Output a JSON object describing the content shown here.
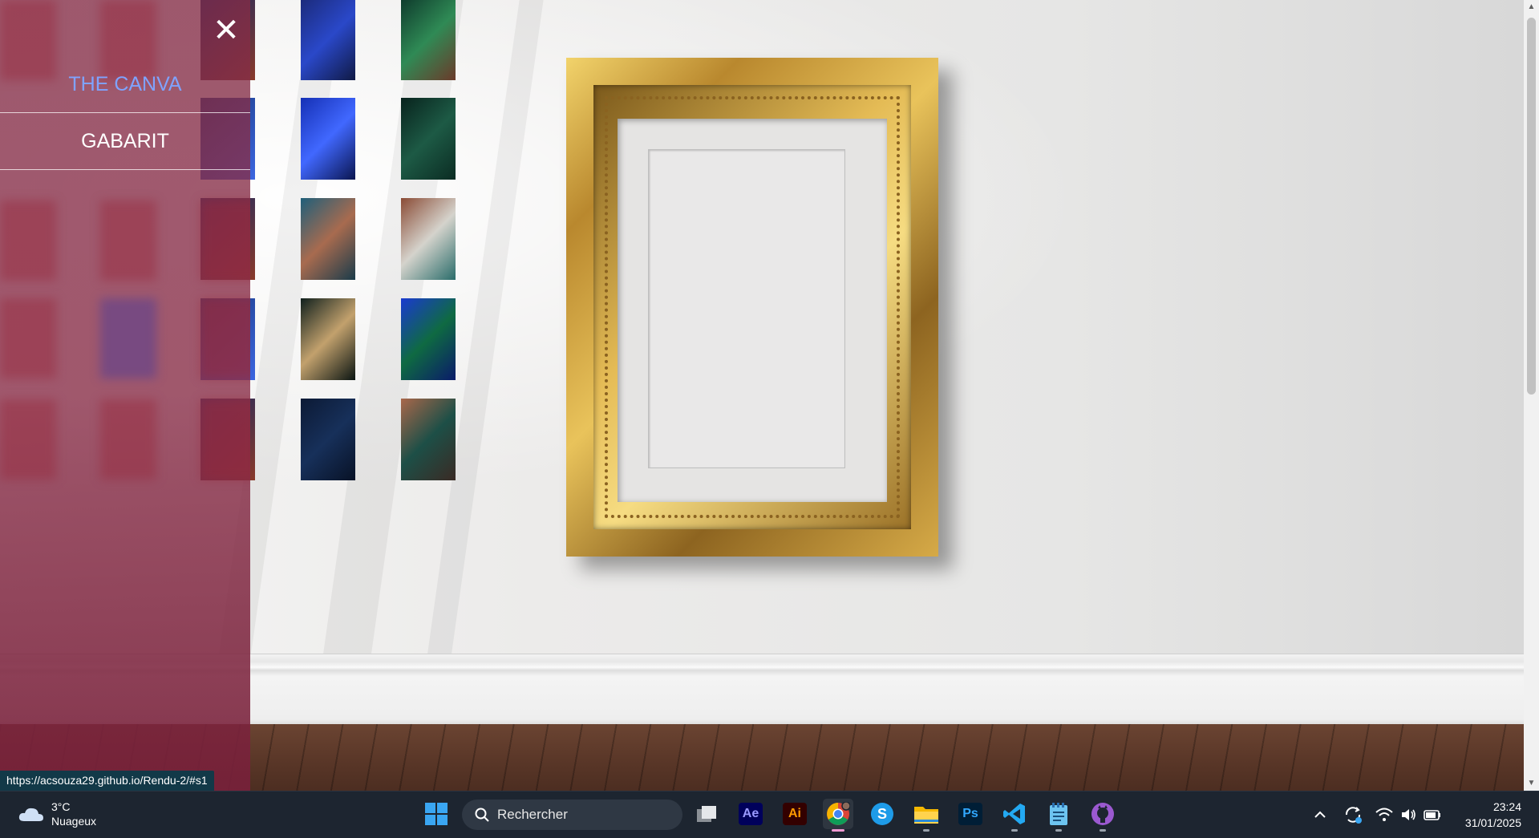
{
  "side_menu": {
    "close_label": "✕",
    "items": [
      {
        "label": "THE CANVA",
        "active": true
      },
      {
        "label": "GABARIT",
        "active": false
      }
    ],
    "url_tooltip": "https://acsouza29.github.io/Rendu-2/#s1"
  },
  "thumbnails": [
    {
      "name": "blue-feathers",
      "colors": [
        "#1b2a7a",
        "#2a48c9",
        "#101a45"
      ]
    },
    {
      "name": "green-leaves-hand",
      "colors": [
        "#0e3a2c",
        "#2f8a55",
        "#6b3a2a"
      ]
    },
    {
      "name": "blue-feathers-2",
      "colors": [
        "#1530b5",
        "#4168ff",
        "#0a1550"
      ]
    },
    {
      "name": "dark-green-leaf",
      "colors": [
        "#08231d",
        "#1d5a45",
        "#0b2c23"
      ]
    },
    {
      "name": "portrait-shoulder",
      "colors": [
        "#1f5f7a",
        "#a86b4f",
        "#1a3b4a"
      ]
    },
    {
      "name": "portrait-arm-tattoo",
      "colors": [
        "#8a4b35",
        "#d5d3cc",
        "#2a6c6a"
      ]
    },
    {
      "name": "dark-doorway",
      "colors": [
        "#10201d",
        "#c2a16d",
        "#0b1512"
      ]
    },
    {
      "name": "blue-feathers-3",
      "colors": [
        "#1a3ad0",
        "#0f6a42",
        "#0a1b6a"
      ]
    },
    {
      "name": "night-blue",
      "colors": [
        "#0c1a35",
        "#17305a",
        "#081226"
      ]
    },
    {
      "name": "portrait-face-paint",
      "colors": [
        "#a9674a",
        "#1d4f47",
        "#3a2a24"
      ]
    }
  ],
  "taskbar": {
    "weather_temp": "3°C",
    "weather_desc": "Nuageux",
    "search_placeholder": "Rechercher",
    "apps": [
      {
        "name": "windows-start-icon"
      },
      {
        "name": "task-view-icon"
      },
      {
        "name": "after-effects-icon",
        "label": "Ae",
        "color": "#9999ff",
        "bg": "#00005b"
      },
      {
        "name": "illustrator-icon",
        "label": "Ai",
        "color": "#ff9a00",
        "bg": "#330000"
      },
      {
        "name": "chrome-icon"
      },
      {
        "name": "skype-icon",
        "label": "S"
      },
      {
        "name": "file-explorer-icon"
      },
      {
        "name": "photoshop-icon",
        "label": "Ps",
        "color": "#31a8ff",
        "bg": "#001e36"
      },
      {
        "name": "vscode-icon"
      },
      {
        "name": "notepad-icon"
      },
      {
        "name": "github-desktop-icon"
      }
    ],
    "time": "23:24",
    "date": "31/01/2025"
  }
}
